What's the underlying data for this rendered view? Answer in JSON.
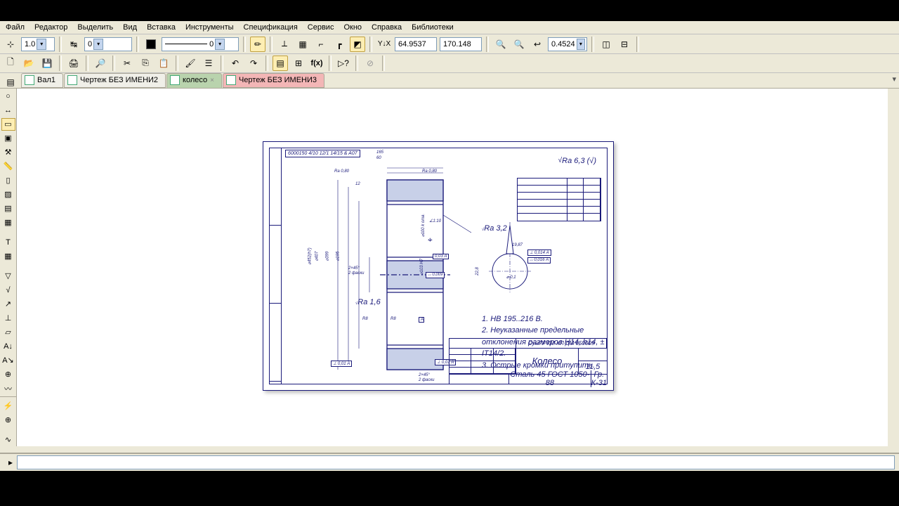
{
  "menu": {
    "file": "Файл",
    "edit": "Редактор",
    "select": "Выделить",
    "view": "Вид",
    "insert": "Вставка",
    "tools": "Инструменты",
    "spec": "Спецификация",
    "service": "Сервис",
    "window": "Окно",
    "help": "Справка",
    "libs": "Библиотеки"
  },
  "toolbar1": {
    "scale": "1.0",
    "layer": "0",
    "linestyle": "0",
    "coord_x": "64.9537",
    "coord_y": "170.148",
    "zoom": "0.4524"
  },
  "tabs": [
    {
      "label": "Вал1",
      "active": false,
      "red": false
    },
    {
      "label": "Чертеж БЕЗ ИМЕНИ2",
      "active": false,
      "red": false
    },
    {
      "label": "колесо",
      "active": true,
      "red": false
    },
    {
      "label": "Чертеж БЕЗ ИМЕНИ3",
      "active": false,
      "red": true
    }
  ],
  "drawing": {
    "gost": "6000150 4/10 12/1 14/15 & A07",
    "surf": "Ra 6,3 (√)",
    "title": {
      "number": "СумГУ КМ КП ДМ 050009",
      "name": "Колесо",
      "material": "Сталь 45 ГОСТ 1050-88",
      "group": "Гр. К-31",
      "mass": "11,5"
    },
    "dims": {
      "top_w1": "165",
      "top_w2": "60",
      "ra_top": "Ra 0,80",
      "ra_top2": "Ra 0,80",
      "l": "12",
      "angle": "∠1:10",
      "mid_ra": "Ra 3,2",
      "slot": "19,87",
      "tol1": "⊥ 0,014 А",
      "tol2": "⌓ 0,016 А",
      "dia": "⌀ 0,1",
      "hd": "⌀452(h7)",
      "hd2": "⌀407",
      "hd3": "⌀399",
      "hd4": "⌀195",
      "chamf": "2×45°",
      "faces": "2 фаски",
      "bot_chamf": "2×45°",
      "bot_faces": "2 фаски",
      "r1": "R8",
      "r2": "R8",
      "tol_perp": "⊥ 0,01 А",
      "ra32": "Ra 3,2",
      "ra16": "Ra 1,6",
      "box_a": "А",
      "tol_003": "0,03 А",
      "tol_0009": "⌓ 0,009",
      "diah": "⌀103 Н7",
      "t228": "22,8",
      "vh": "⌀100 k отв."
    },
    "notes": [
      "1. HB 195..216 B.",
      "2. Неуказанные предельные отклонения размеров H14, h14, ± IT14/2.",
      "3. Острые кромки притупить."
    ]
  }
}
